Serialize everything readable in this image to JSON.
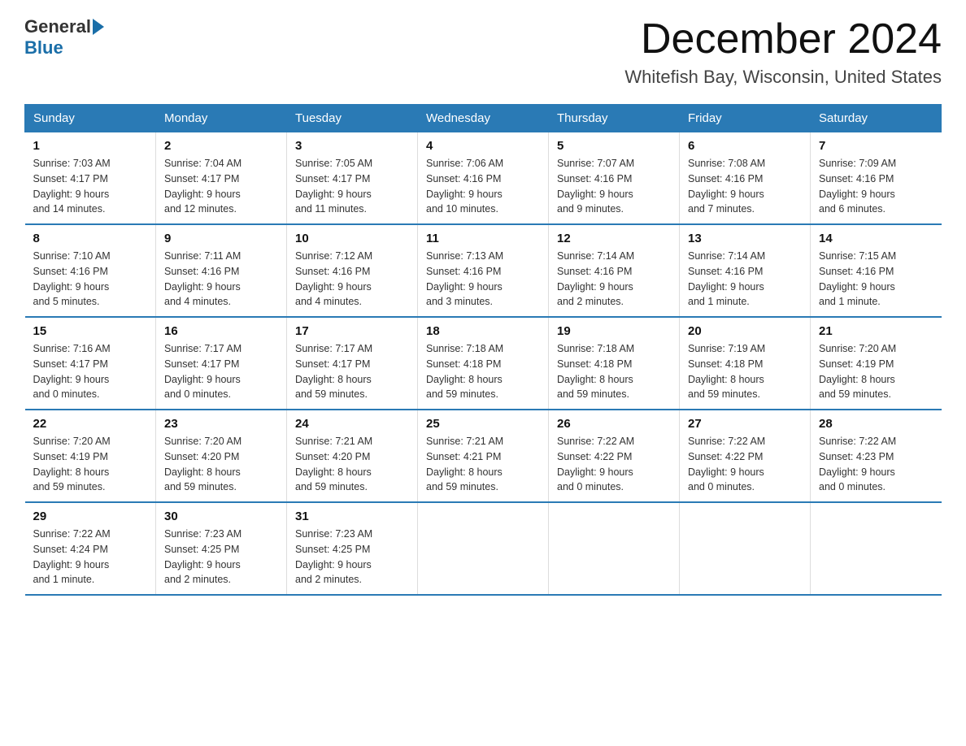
{
  "logo": {
    "general": "General",
    "blue": "Blue"
  },
  "title": {
    "month": "December 2024",
    "location": "Whitefish Bay, Wisconsin, United States"
  },
  "headers": [
    "Sunday",
    "Monday",
    "Tuesday",
    "Wednesday",
    "Thursday",
    "Friday",
    "Saturday"
  ],
  "weeks": [
    [
      {
        "day": "1",
        "sunrise": "7:03 AM",
        "sunset": "4:17 PM",
        "daylight": "9 hours and 14 minutes."
      },
      {
        "day": "2",
        "sunrise": "7:04 AM",
        "sunset": "4:17 PM",
        "daylight": "9 hours and 12 minutes."
      },
      {
        "day": "3",
        "sunrise": "7:05 AM",
        "sunset": "4:17 PM",
        "daylight": "9 hours and 11 minutes."
      },
      {
        "day": "4",
        "sunrise": "7:06 AM",
        "sunset": "4:16 PM",
        "daylight": "9 hours and 10 minutes."
      },
      {
        "day": "5",
        "sunrise": "7:07 AM",
        "sunset": "4:16 PM",
        "daylight": "9 hours and 9 minutes."
      },
      {
        "day": "6",
        "sunrise": "7:08 AM",
        "sunset": "4:16 PM",
        "daylight": "9 hours and 7 minutes."
      },
      {
        "day": "7",
        "sunrise": "7:09 AM",
        "sunset": "4:16 PM",
        "daylight": "9 hours and 6 minutes."
      }
    ],
    [
      {
        "day": "8",
        "sunrise": "7:10 AM",
        "sunset": "4:16 PM",
        "daylight": "9 hours and 5 minutes."
      },
      {
        "day": "9",
        "sunrise": "7:11 AM",
        "sunset": "4:16 PM",
        "daylight": "9 hours and 4 minutes."
      },
      {
        "day": "10",
        "sunrise": "7:12 AM",
        "sunset": "4:16 PM",
        "daylight": "9 hours and 4 minutes."
      },
      {
        "day": "11",
        "sunrise": "7:13 AM",
        "sunset": "4:16 PM",
        "daylight": "9 hours and 3 minutes."
      },
      {
        "day": "12",
        "sunrise": "7:14 AM",
        "sunset": "4:16 PM",
        "daylight": "9 hours and 2 minutes."
      },
      {
        "day": "13",
        "sunrise": "7:14 AM",
        "sunset": "4:16 PM",
        "daylight": "9 hours and 1 minute."
      },
      {
        "day": "14",
        "sunrise": "7:15 AM",
        "sunset": "4:16 PM",
        "daylight": "9 hours and 1 minute."
      }
    ],
    [
      {
        "day": "15",
        "sunrise": "7:16 AM",
        "sunset": "4:17 PM",
        "daylight": "9 hours and 0 minutes."
      },
      {
        "day": "16",
        "sunrise": "7:17 AM",
        "sunset": "4:17 PM",
        "daylight": "9 hours and 0 minutes."
      },
      {
        "day": "17",
        "sunrise": "7:17 AM",
        "sunset": "4:17 PM",
        "daylight": "8 hours and 59 minutes."
      },
      {
        "day": "18",
        "sunrise": "7:18 AM",
        "sunset": "4:18 PM",
        "daylight": "8 hours and 59 minutes."
      },
      {
        "day": "19",
        "sunrise": "7:18 AM",
        "sunset": "4:18 PM",
        "daylight": "8 hours and 59 minutes."
      },
      {
        "day": "20",
        "sunrise": "7:19 AM",
        "sunset": "4:18 PM",
        "daylight": "8 hours and 59 minutes."
      },
      {
        "day": "21",
        "sunrise": "7:20 AM",
        "sunset": "4:19 PM",
        "daylight": "8 hours and 59 minutes."
      }
    ],
    [
      {
        "day": "22",
        "sunrise": "7:20 AM",
        "sunset": "4:19 PM",
        "daylight": "8 hours and 59 minutes."
      },
      {
        "day": "23",
        "sunrise": "7:20 AM",
        "sunset": "4:20 PM",
        "daylight": "8 hours and 59 minutes."
      },
      {
        "day": "24",
        "sunrise": "7:21 AM",
        "sunset": "4:20 PM",
        "daylight": "8 hours and 59 minutes."
      },
      {
        "day": "25",
        "sunrise": "7:21 AM",
        "sunset": "4:21 PM",
        "daylight": "8 hours and 59 minutes."
      },
      {
        "day": "26",
        "sunrise": "7:22 AM",
        "sunset": "4:22 PM",
        "daylight": "9 hours and 0 minutes."
      },
      {
        "day": "27",
        "sunrise": "7:22 AM",
        "sunset": "4:22 PM",
        "daylight": "9 hours and 0 minutes."
      },
      {
        "day": "28",
        "sunrise": "7:22 AM",
        "sunset": "4:23 PM",
        "daylight": "9 hours and 0 minutes."
      }
    ],
    [
      {
        "day": "29",
        "sunrise": "7:22 AM",
        "sunset": "4:24 PM",
        "daylight": "9 hours and 1 minute."
      },
      {
        "day": "30",
        "sunrise": "7:23 AM",
        "sunset": "4:25 PM",
        "daylight": "9 hours and 2 minutes."
      },
      {
        "day": "31",
        "sunrise": "7:23 AM",
        "sunset": "4:25 PM",
        "daylight": "9 hours and 2 minutes."
      },
      null,
      null,
      null,
      null
    ]
  ],
  "labels": {
    "sunrise": "Sunrise:",
    "sunset": "Sunset:",
    "daylight": "Daylight:"
  }
}
